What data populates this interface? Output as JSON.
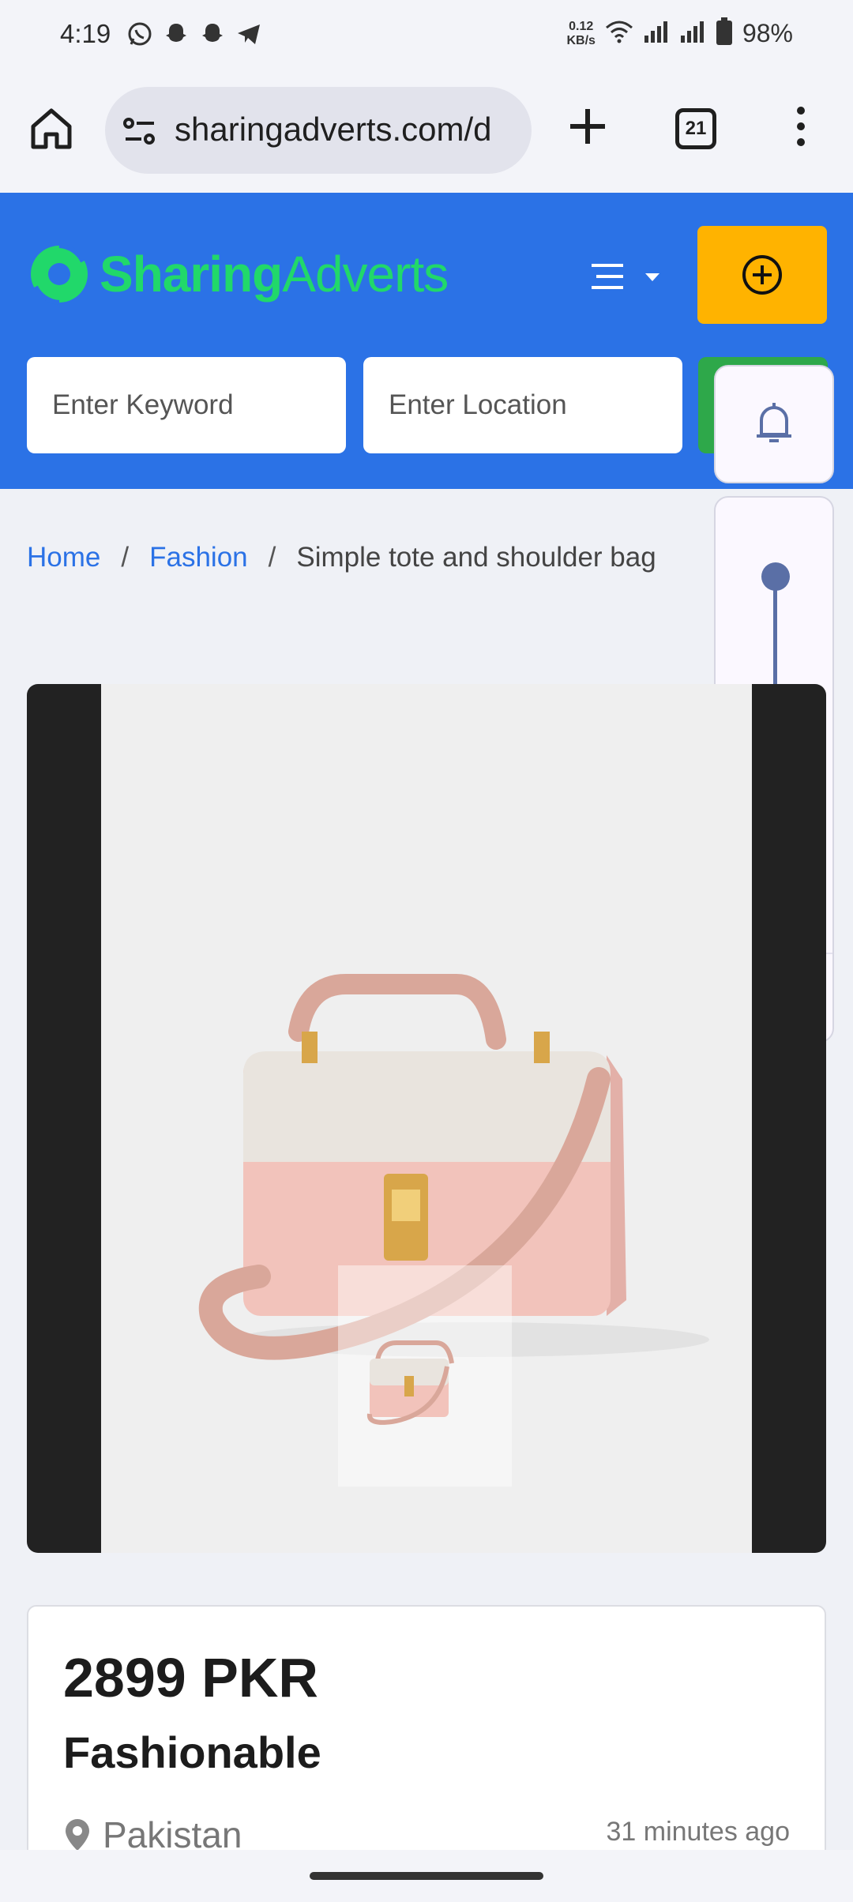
{
  "status_bar": {
    "time": "4:19",
    "apps": [
      "whatsapp-icon",
      "snapchat-icon",
      "snapchat-icon",
      "telegram-icon"
    ],
    "net_speed_value": "0.12",
    "net_speed_unit": "KB/s",
    "battery": "98%"
  },
  "browser": {
    "url": "sharingadverts.com/d",
    "tab_count": "21"
  },
  "site": {
    "logo_bold": "Sharing",
    "logo_light": "Adverts",
    "brand_color": "#2b72e6",
    "search": {
      "keyword_placeholder": "Enter Keyword",
      "location_placeholder": "Enter Location"
    }
  },
  "breadcrumb": {
    "home": "Home",
    "category": "Fashion",
    "current": "Simple tote and shoulder bag",
    "separator": "/"
  },
  "listing": {
    "price": "2899 PKR",
    "title": "Fashionable",
    "location": "Pakistan",
    "posted": "31 minutes ago"
  },
  "volume_panel": {
    "level": 1.0
  }
}
